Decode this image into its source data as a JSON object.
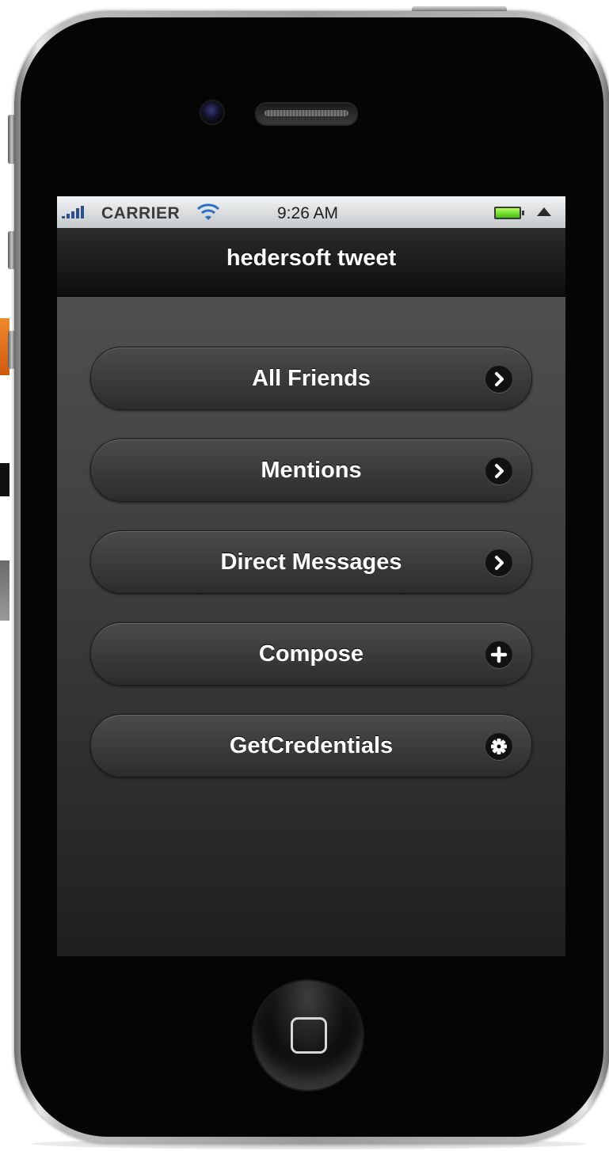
{
  "status_bar": {
    "carrier": "CARRIER",
    "time": "9:26 AM",
    "wifi_icon": "wifi-icon",
    "battery_icon": "battery-icon",
    "location_icon": "location-arrow-icon"
  },
  "header": {
    "title": "hedersoft tweet"
  },
  "menu": {
    "items": [
      {
        "label": "All Friends",
        "icon": "chevron-right-icon"
      },
      {
        "label": "Mentions",
        "icon": "chevron-right-icon"
      },
      {
        "label": "Direct Messages",
        "icon": "chevron-right-icon"
      },
      {
        "label": "Compose",
        "icon": "plus-icon"
      },
      {
        "label": "GetCredentials",
        "icon": "gear-icon"
      }
    ]
  },
  "colors": {
    "header_background": "#1a1a1a",
    "button_background": "#3a3a3a",
    "status_bar_background": "#dcdfe1",
    "text": "#ffffff",
    "battery": "#5fd11c"
  }
}
